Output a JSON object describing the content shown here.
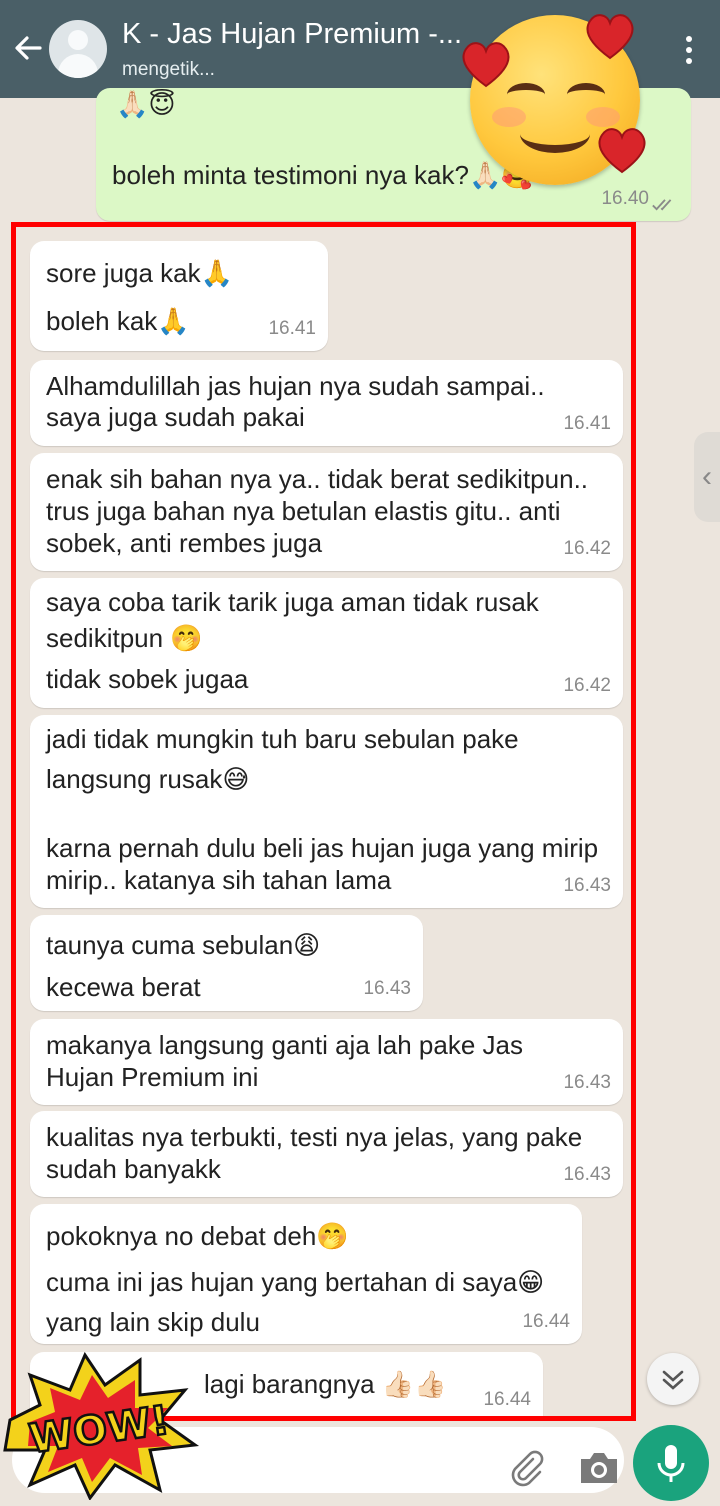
{
  "header": {
    "title": "K - Jas Hujan Premium -...",
    "status": "mengetik..."
  },
  "outgoing": {
    "top_emoji": "🙏🏻😇",
    "text": "boleh minta testimoni nya kak?🙏🏻🥰",
    "time": "16.40"
  },
  "messages": [
    {
      "lines": [
        "sore juga kak🙏",
        "boleh kak🙏"
      ],
      "time": "16.41"
    },
    {
      "lines": [
        "Alhamdulillah jas hujan nya sudah sampai..",
        "saya juga sudah pakai"
      ],
      "time": "16.41"
    },
    {
      "lines": [
        "enak sih bahan nya ya.. tidak berat sedikitpun..",
        "trus juga bahan nya betulan elastis gitu.. anti",
        "sobek, anti rembes juga"
      ],
      "time": "16.42"
    },
    {
      "lines": [
        "saya coba tarik tarik juga aman tidak rusak",
        "sedikitpun 🤭",
        "tidak sobek jugaa"
      ],
      "time": "16.42"
    },
    {
      "lines": [
        "jadi tidak mungkin tuh baru sebulan pake",
        "langsung rusak😅",
        "",
        "karna pernah dulu beli jas hujan juga yang mirip",
        "mirip.. katanya sih tahan lama"
      ],
      "time": "16.43"
    },
    {
      "lines": [
        "taunya cuma sebulan😩",
        "kecewa berat"
      ],
      "time": "16.43"
    },
    {
      "lines": [
        "makanya langsung ganti aja lah pake Jas",
        "Hujan Premium ini"
      ],
      "time": "16.43"
    },
    {
      "lines": [
        "kualitas nya terbukti, testi nya jelas, yang pake",
        "sudah banyakk"
      ],
      "time": "16.43"
    },
    {
      "lines": [
        "pokoknya no debat deh🤭",
        "cuma ini jas hujan yang bertahan di saya😁",
        "yang lain skip dulu"
      ],
      "time": "16.44"
    },
    {
      "lines": [
        "lagi barangnya 👍🏻👍🏻"
      ],
      "time": "16.44"
    }
  ],
  "sticker": {
    "text": "WOW!"
  },
  "colors": {
    "header_bg": "#4a5f67",
    "chat_bg": "#ece5dd",
    "outgoing_bubble": "#dcf8c6",
    "incoming_bubble": "#ffffff",
    "highlight_frame": "#ff0000",
    "mic_button": "#1aa37d"
  },
  "icons": [
    "back-arrow-icon",
    "avatar-icon",
    "more-vert-icon",
    "attach-icon",
    "camera-icon",
    "mic-icon",
    "double-chevron-down-icon",
    "read-receipt-icon"
  ]
}
